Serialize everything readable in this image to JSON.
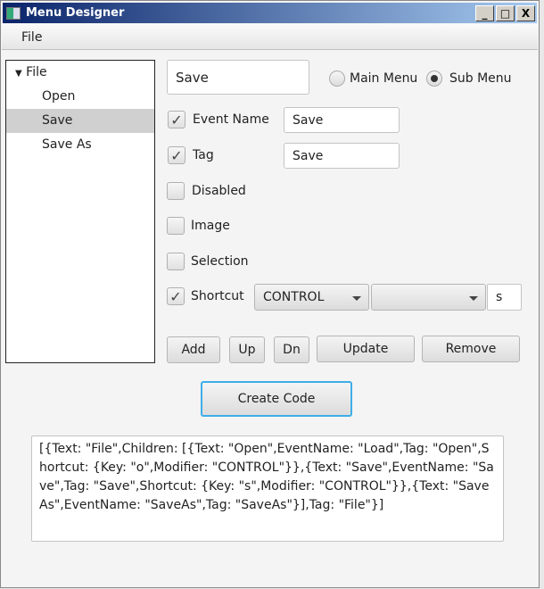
{
  "window": {
    "title": "Menu Designer",
    "minimize": "_",
    "maximize": "□",
    "close": "X"
  },
  "menubar": {
    "file": "File"
  },
  "tree": {
    "root": "File",
    "children": [
      "Open",
      "Save",
      "Save As"
    ],
    "selected": "Save"
  },
  "form": {
    "text_value": "Save",
    "radio_main": "Main Menu",
    "radio_sub": "Sub Menu",
    "radio_selected": "Sub Menu",
    "event_name": {
      "label": "Event Name",
      "checked": true,
      "value": "Save"
    },
    "tag": {
      "label": "Tag",
      "checked": true,
      "value": "Save"
    },
    "disabled": {
      "label": "Disabled",
      "checked": false
    },
    "image": {
      "label": "Image",
      "checked": false
    },
    "selection": {
      "label": "Selection",
      "checked": false
    },
    "shortcut": {
      "label": "Shortcut",
      "checked": true,
      "modifier": "CONTROL",
      "modifier2": "",
      "key": "s"
    },
    "check_glyph": "✓"
  },
  "buttons": {
    "add": "Add",
    "up": "Up",
    "dn": "Dn",
    "update": "Update",
    "remove": "Remove",
    "create": "Create Code"
  },
  "output": "[{Text: \"File\",Children: [{Text: \"Open\",EventName: \"Load\",Tag: \"Open\",Shortcut: {Key: \"o\",Modifier: \"CONTROL\"}},{Text: \"Save\",EventName: \"Save\",Tag: \"Save\",Shortcut: {Key: \"s\",Modifier: \"CONTROL\"}},{Text: \"Save As\",EventName: \"SaveAs\",Tag: \"SaveAs\"}],Tag: \"File\"}]"
}
